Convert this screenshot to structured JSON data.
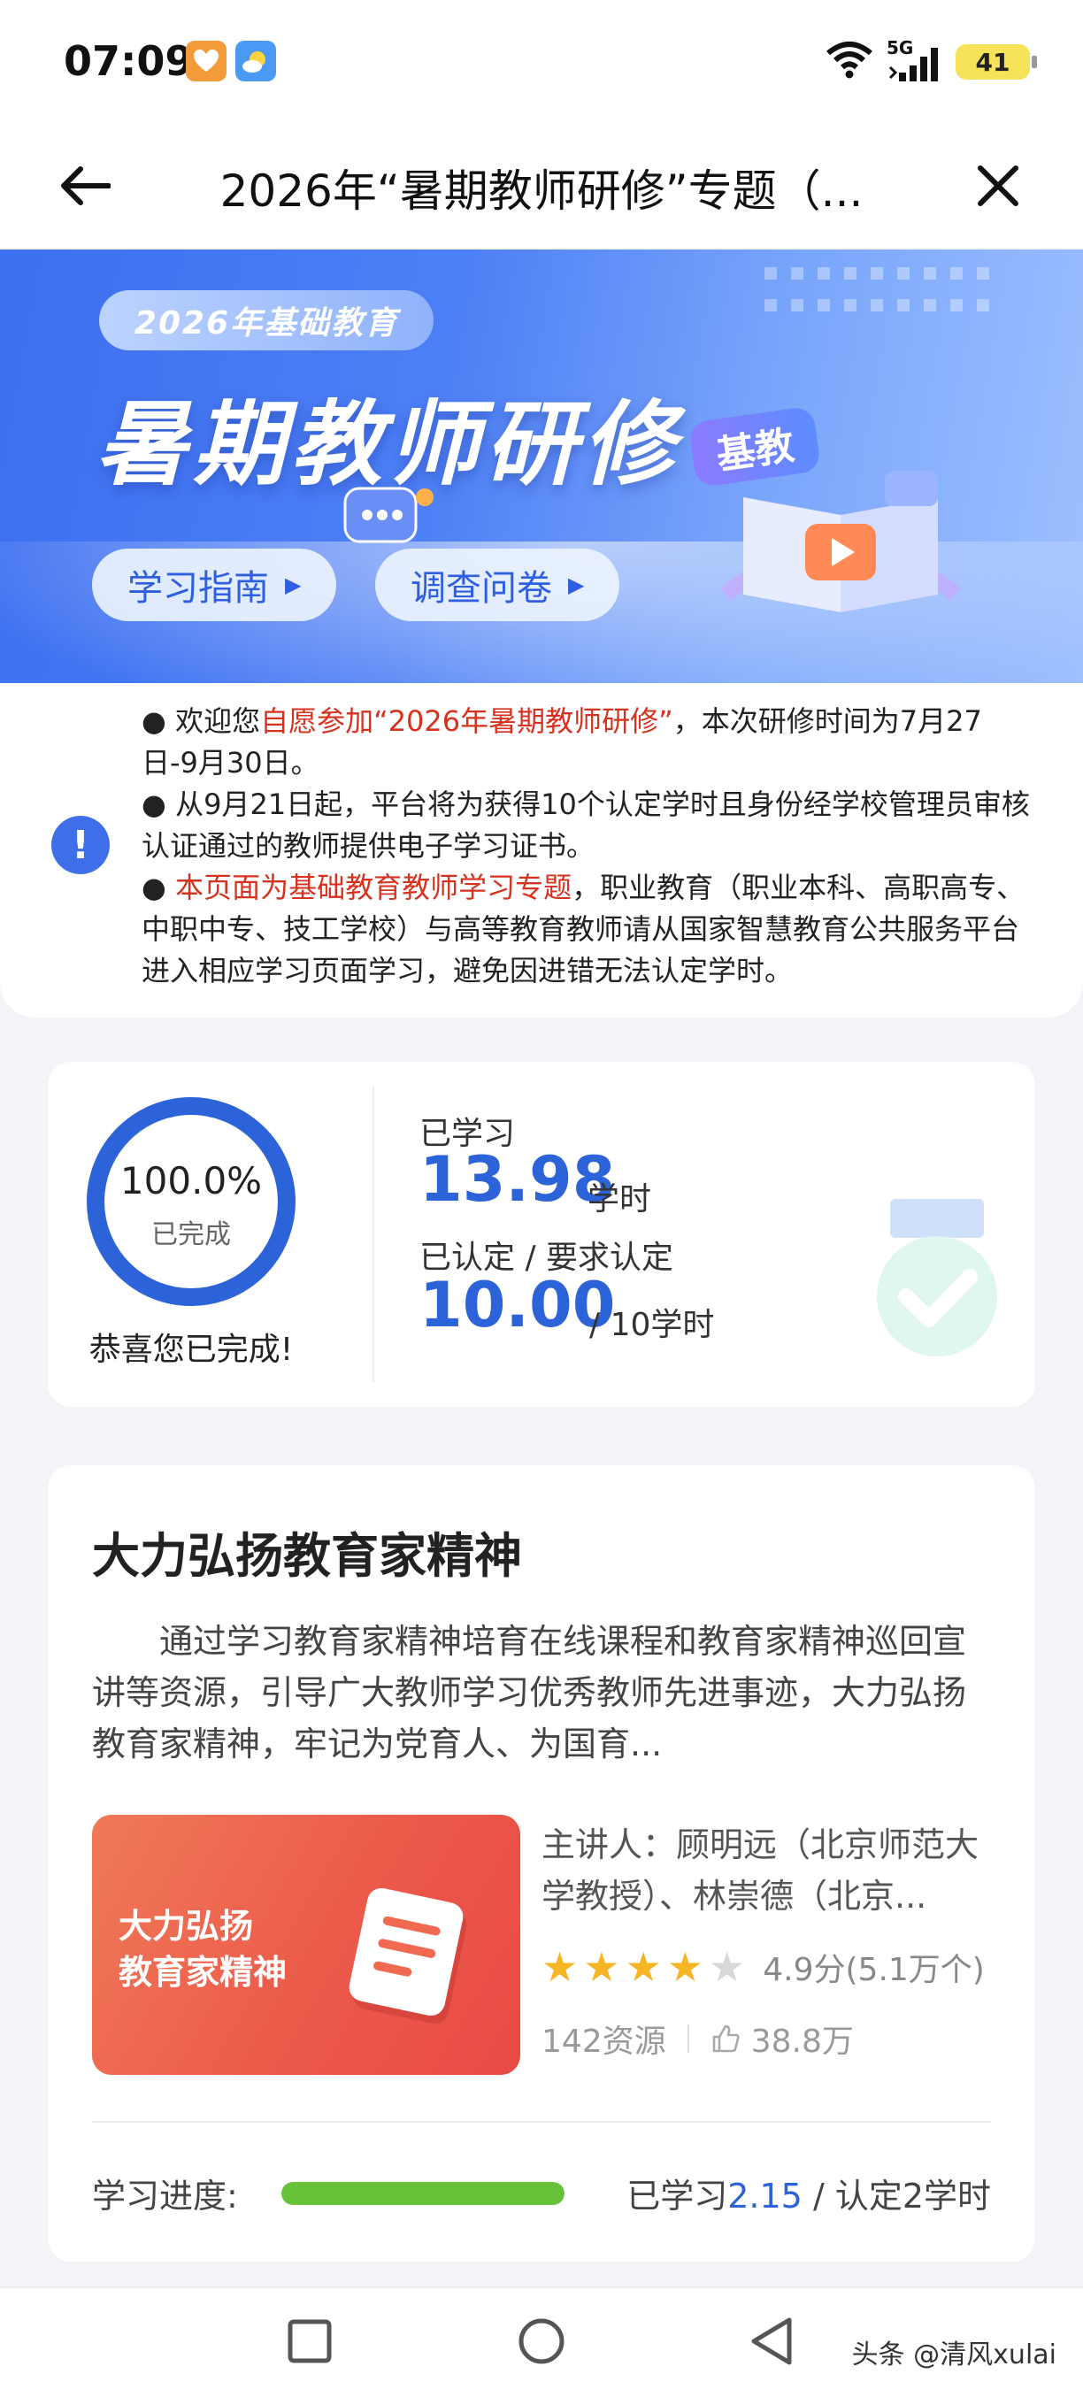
{
  "status_bar": {
    "time": "07:09",
    "network": "5G",
    "battery": "41"
  },
  "header": {
    "title": "2026年“暑期教师研修”专题（..."
  },
  "banner": {
    "pill": "2026年基础教育",
    "title": "暑期教师研修",
    "tag": "基教",
    "buttons": [
      "学习指南",
      "调查问卷"
    ]
  },
  "notice": {
    "items": [
      {
        "prefix": "● 欢迎您",
        "highlight": "自愿参加“2026年暑期教师研修”",
        "suffix": "，本次研修时间为7月27日-9月30日。"
      },
      {
        "prefix": "● 从9月21日起，平台将为获得10个认定学时且身份经学校管理员审核认证通过的教师提供电子学习证书。",
        "highlight": "",
        "suffix": ""
      },
      {
        "prefix": "● ",
        "highlight": "本页面为基础教育教师学习专题",
        "suffix": "，职业教育（职业本科、高职高专、中职中专、技工学校）与高等教育教师请从国家智慧教育公共服务平台进入相应学习页面学习，避免因进错无法认定学时。"
      }
    ]
  },
  "summary": {
    "percent_text": "100.0%",
    "percent_value": 1.0,
    "completed_label": "已完成",
    "congrats": "恭喜您已完成!",
    "studied_label": "已学习",
    "studied_value": "13.98",
    "studied_unit": "学时",
    "certified_label": "已认定 / 要求认定",
    "certified_value": "10.00",
    "certified_unit": "/ 10学时"
  },
  "course": {
    "title": "大力弘扬教育家精神",
    "description": "通过学习教育家精神培育在线课程和教育家精神巡回宣讲等资源，引导广大教师学习优秀教师先进事迹，大力弘扬教育家精神，牢记为党育人、为国育...",
    "thumb_lines": [
      "大力弘扬",
      "教育家精神"
    ],
    "speaker": "主讲人：顾明远（北京师范大学教授）、林崇德（北京...",
    "rating_stars": 4,
    "rating_text": "4.9分(5.1万个)",
    "resources": "142资源",
    "likes": "38.8万",
    "progress_label": "学习进度:",
    "progress_value": 1.0,
    "progress_prefix": "已学习",
    "progress_studied": "2.15",
    "progress_suffix": " / 认定2学时"
  },
  "watermark": "头条 @清风xulai",
  "colors": {
    "accent_blue": "#2d63d8",
    "highlight_red": "#d6321f",
    "progress_green": "#67c23a",
    "star_yellow": "#f6b524"
  }
}
